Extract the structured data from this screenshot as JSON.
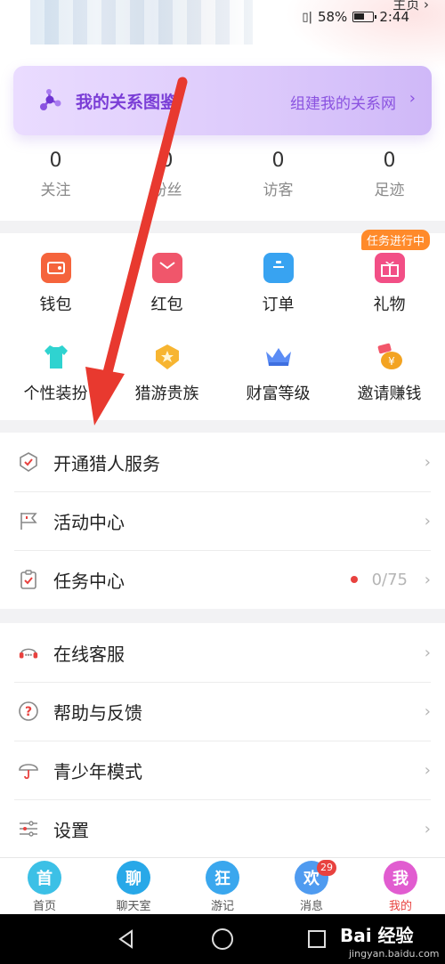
{
  "status_bar": {
    "battery": "58%",
    "time": "2:44",
    "homepage_link": "主页"
  },
  "banner": {
    "title": "我的关系图鉴",
    "link": "组建我的关系网"
  },
  "stats": [
    {
      "value": "0",
      "label": "关注"
    },
    {
      "value": "0",
      "label": "粉丝"
    },
    {
      "value": "0",
      "label": "访客"
    },
    {
      "value": "0",
      "label": "足迹"
    }
  ],
  "grid": {
    "task_badge": "任务进行中",
    "items": [
      {
        "label": "钱包",
        "icon": "wallet-icon",
        "color": "#f5643c"
      },
      {
        "label": "红包",
        "icon": "red-envelope-icon",
        "color": "#f0566b"
      },
      {
        "label": "订单",
        "icon": "order-icon",
        "color": "#38a3f1"
      },
      {
        "label": "礼物",
        "icon": "gift-icon",
        "color": "#f24f86"
      },
      {
        "label": "个性装扮",
        "icon": "tshirt-icon",
        "color": "#2fd3d0"
      },
      {
        "label": "猎游贵族",
        "icon": "noble-badge-icon",
        "color": "#f7b531"
      },
      {
        "label": "财富等级",
        "icon": "crown-icon",
        "color": "#5b8cf5"
      },
      {
        "label": "邀请赚钱",
        "icon": "money-bag-icon",
        "color": "#f3a321"
      }
    ]
  },
  "list1": [
    {
      "label": "开通猎人服务",
      "icon": "shield-check-icon"
    },
    {
      "label": "活动中心",
      "icon": "flag-icon"
    },
    {
      "label": "任务中心",
      "icon": "clipboard-check-icon",
      "value": "0/75"
    }
  ],
  "list2": [
    {
      "label": "在线客服",
      "icon": "headset-icon"
    },
    {
      "label": "帮助与反馈",
      "icon": "help-icon"
    },
    {
      "label": "青少年模式",
      "icon": "umbrella-icon"
    },
    {
      "label": "设置",
      "icon": "settings-sliders-icon"
    }
  ],
  "tabbar": {
    "tabs": [
      {
        "label": "首页",
        "glyph": "首",
        "color": "#3cc0e6"
      },
      {
        "label": "聊天室",
        "glyph": "聊",
        "color": "#28a8e8"
      },
      {
        "label": "游记",
        "glyph": "狂",
        "color": "#3aa7ee"
      },
      {
        "label": "消息",
        "glyph": "欢",
        "color": "#4f9bf0",
        "badge": "29"
      },
      {
        "label": "我的",
        "glyph": "我",
        "color": "#e15cd0"
      }
    ]
  },
  "watermark": {
    "brand": "Bai 经验",
    "url": "jingyan.baidu.com"
  },
  "colors": {
    "accent_red": "#e8423f",
    "banner_purple": "#7a3dd6",
    "arrow_red": "#e8392f"
  }
}
